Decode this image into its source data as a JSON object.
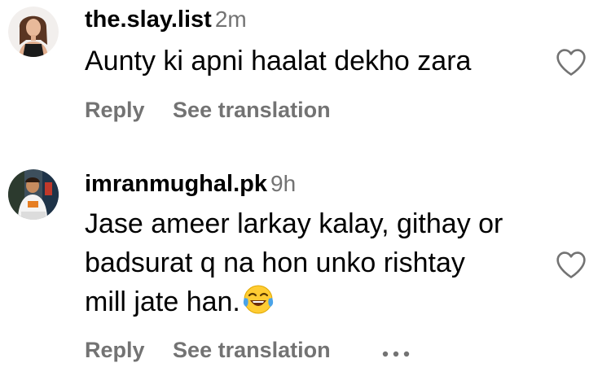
{
  "comments": [
    {
      "username": "the.slay.list",
      "time": "2m",
      "text": "Aunty ki apni haalat dekho zara",
      "reply_label": "Reply",
      "translate_label": "See translation"
    },
    {
      "username": "imranmughal.pk",
      "time": "9h",
      "text_lines": [
        "Jase ameer larkay kalay, githay or",
        "badsurat q na hon unko rishtay",
        "mill jate han."
      ],
      "emoji": "face-with-tears-of-joy",
      "reply_label": "Reply",
      "translate_label": "See translation",
      "more_icon": "more-options-icon"
    }
  ],
  "icons": {
    "like": "heart-outline-icon"
  },
  "colors": {
    "text": "#000000",
    "secondary": "#737373",
    "background": "#ffffff"
  }
}
